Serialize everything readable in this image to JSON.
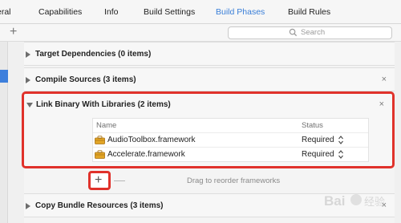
{
  "tabs": [
    {
      "label": "eral"
    },
    {
      "label": "Capabilities"
    },
    {
      "label": "Info"
    },
    {
      "label": "Build Settings"
    },
    {
      "label": "Build Phases"
    },
    {
      "label": "Build Rules"
    }
  ],
  "active_tab": "Build Phases",
  "toolbar": {
    "add_label": "+",
    "search_placeholder": "Search"
  },
  "phases": {
    "target_dependencies": "Target Dependencies (0 items)",
    "compile_sources": "Compile Sources (3 items)",
    "link_binary": "Link Binary With Libraries (2 items)",
    "copy_bundle": "Copy Bundle Resources (3 items)"
  },
  "close_label": "×",
  "library_table": {
    "col_name": "Name",
    "col_status": "Status",
    "rows": [
      {
        "name": "AudioToolbox.framework",
        "status": "Required"
      },
      {
        "name": "Accelerate.framework",
        "status": "Required"
      }
    ]
  },
  "add_remove": {
    "add_label": "+",
    "remove_label": "—",
    "drag_hint": "Drag to reorder frameworks"
  },
  "watermark": "Baidu 经验",
  "colors": {
    "accent": "#3a7fd8",
    "highlight": "#e0322b"
  }
}
